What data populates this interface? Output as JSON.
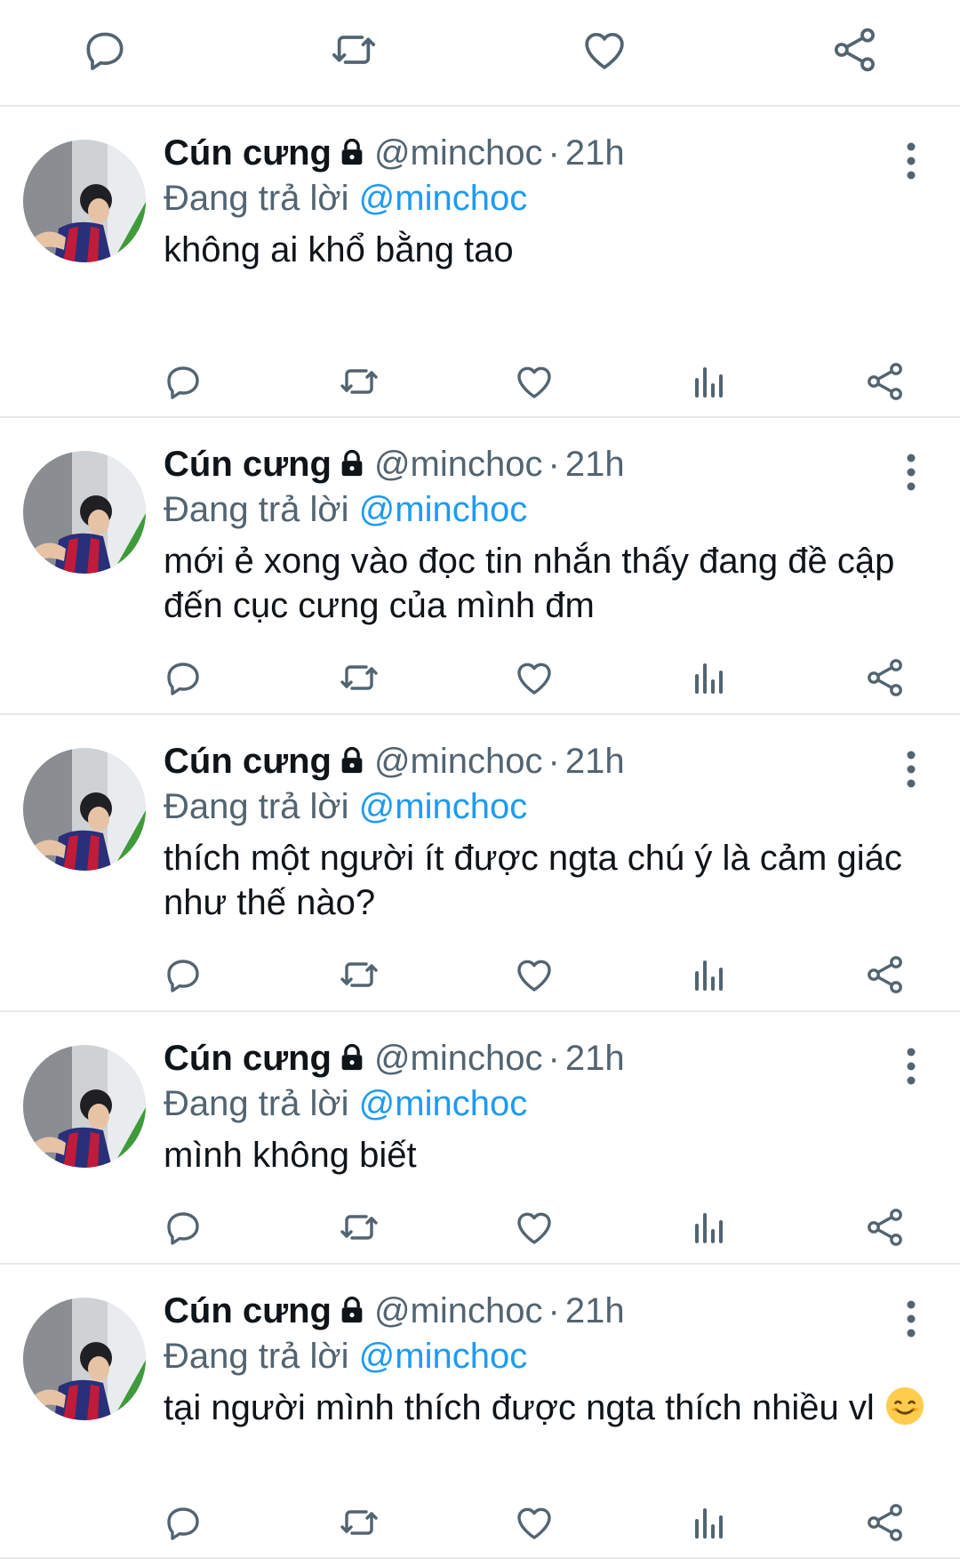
{
  "top_actions": {
    "icons": [
      "reply-icon",
      "retweet-icon",
      "like-icon",
      "share-icon"
    ]
  },
  "tweets": [
    {
      "author_name": "Cún cưng",
      "handle": "@minchoc",
      "separator": "·",
      "time": "21h",
      "reply_prefix": "Đang trả lời",
      "reply_to": "@minchoc",
      "text": "không ai khổ bằng tao"
    },
    {
      "author_name": "Cún cưng",
      "handle": "@minchoc",
      "separator": "·",
      "time": "21h",
      "reply_prefix": "Đang trả lời",
      "reply_to": "@minchoc",
      "text": "mới ẻ xong vào đọc tin nhắn thấy đang đề cập đến cục cưng của mình đm"
    },
    {
      "author_name": "Cún cưng",
      "handle": "@minchoc",
      "separator": "·",
      "time": "21h",
      "reply_prefix": "Đang trả lời",
      "reply_to": "@minchoc",
      "text": "thích một người ít được ngta chú ý là cảm giác như thế nào?"
    },
    {
      "author_name": "Cún cưng",
      "handle": "@minchoc",
      "separator": "·",
      "time": "21h",
      "reply_prefix": "Đang trả lời",
      "reply_to": "@minchoc",
      "text": "mình không biết"
    },
    {
      "author_name": "Cún cưng",
      "handle": "@minchoc",
      "separator": "·",
      "time": "21h",
      "reply_prefix": "Đang trả lời",
      "reply_to": "@minchoc",
      "text": "tại người mình thích được ngta thích nhiều vl",
      "emoji": "smiling-face-emoji"
    }
  ],
  "colors": {
    "text": "#0f1419",
    "secondary": "#536471",
    "accent": "#1d9bf0",
    "divider": "#e6e9eb"
  }
}
